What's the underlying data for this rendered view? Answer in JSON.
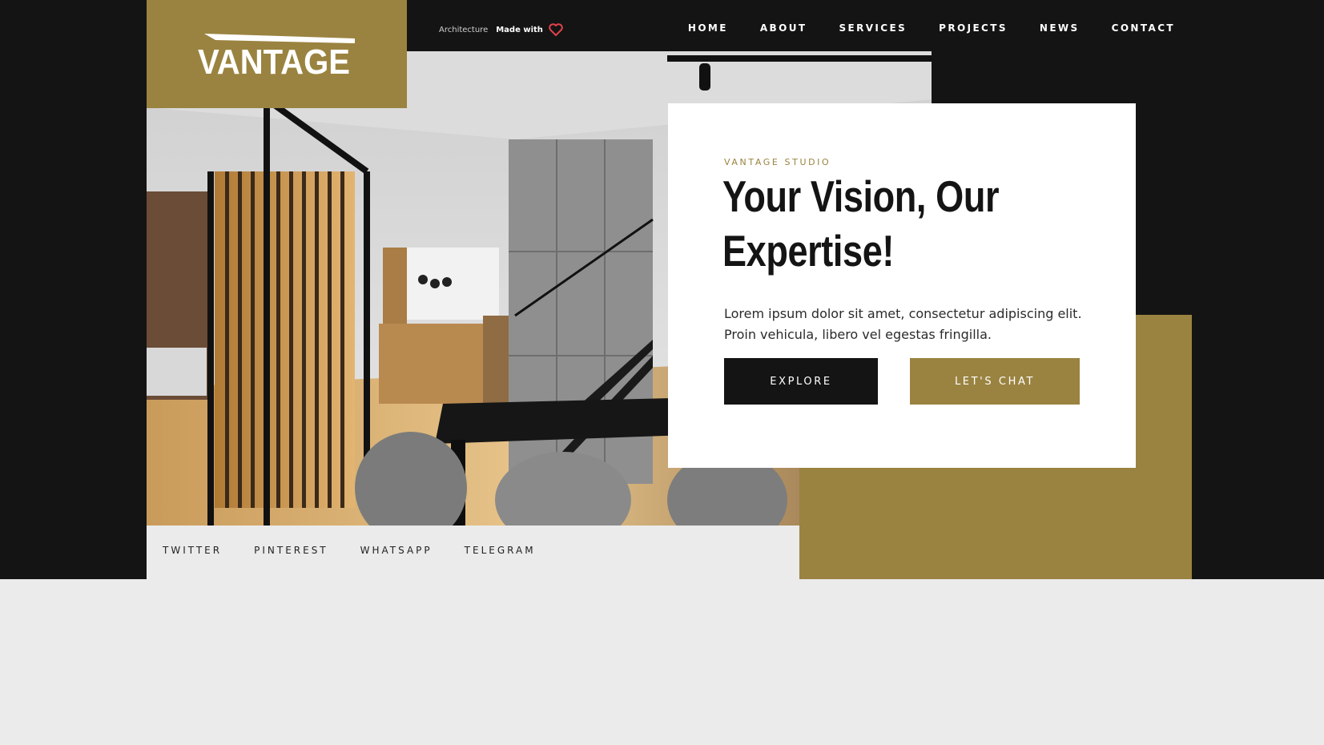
{
  "brand": {
    "logo_text": "VANTAGE",
    "accent": "#9a8340",
    "dark": "#141414"
  },
  "tagline": {
    "category": "Architecture",
    "made_with": "Made with",
    "icon": "heart-icon",
    "heart_color": "#e0424b"
  },
  "nav": {
    "items": [
      "HOME",
      "ABOUT",
      "SERVICES",
      "PROJECTS",
      "NEWS",
      "CONTACT"
    ]
  },
  "hero": {
    "eyebrow": "VANTAGE STUDIO",
    "title_line1": "Your Vision, Our",
    "title_line2": "Expertise!",
    "text_line1": "Lorem ipsum dolor sit amet, consectetur adipiscing elit.",
    "text_line2": "Proin vehicula, libero vel egestas fringilla.",
    "explore_label": "EXPLORE",
    "chat_label": "LET'S CHAT"
  },
  "social": {
    "items": [
      "TWITTER",
      "PINTEREST",
      "WHATSAPP",
      "TELEGRAM"
    ]
  }
}
